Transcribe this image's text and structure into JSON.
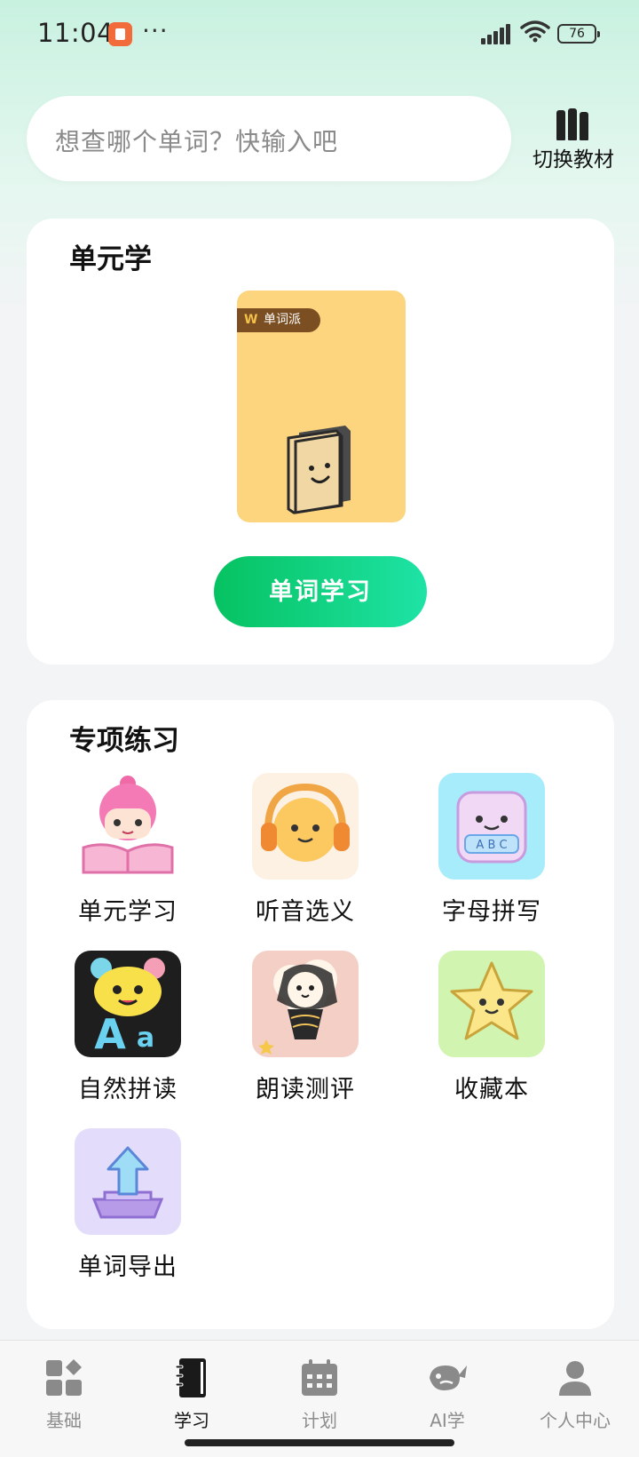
{
  "status_bar": {
    "time": "11:04",
    "more": "···",
    "battery": "76"
  },
  "search": {
    "placeholder": "想查哪个单词？快输入吧"
  },
  "switch_textbook": {
    "label": "切换教材"
  },
  "unit_card": {
    "title": "单元学",
    "brand": "单词派",
    "learn_button": "单词学习"
  },
  "practice_card": {
    "title": "专项练习",
    "items": [
      {
        "label": "单元学习",
        "icon": "reading-girl-icon"
      },
      {
        "label": "听音选义",
        "icon": "headphones-icon"
      },
      {
        "label": "字母拼写",
        "icon": "abc-block-icon"
      },
      {
        "label": "自然拼读",
        "icon": "phonics-aa-icon"
      },
      {
        "label": "朗读测评",
        "icon": "microphone-icon"
      },
      {
        "label": "收藏本",
        "icon": "star-icon"
      },
      {
        "label": "单词导出",
        "icon": "export-arrow-icon"
      }
    ]
  },
  "tab_bar": {
    "tabs": [
      {
        "label": "基础",
        "icon": "grid-icon"
      },
      {
        "label": "学习",
        "icon": "notebook-icon"
      },
      {
        "label": "计划",
        "icon": "calendar-icon"
      },
      {
        "label": "AI学",
        "icon": "whale-icon"
      },
      {
        "label": "个人中心",
        "icon": "person-icon"
      }
    ],
    "active": "学习"
  },
  "colors": {
    "accent_green": "#06c261",
    "cover_yellow": "#fdd57f"
  }
}
